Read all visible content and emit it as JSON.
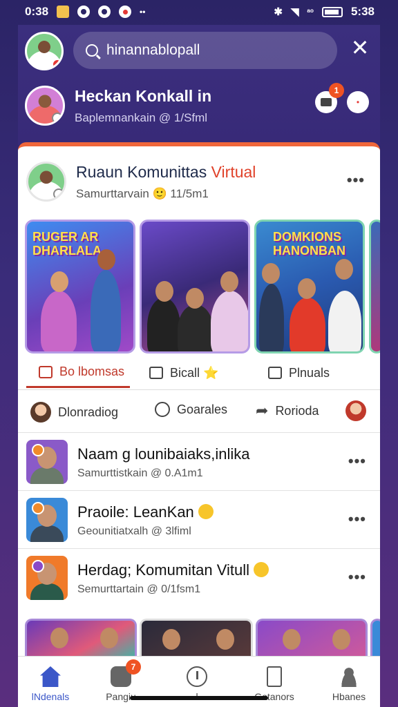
{
  "status_bar": {
    "time": "0:38",
    "right_time": "5:38",
    "network_label": "ᵃᵒ"
  },
  "header": {
    "search_placeholder": "hinannablopall",
    "profile_name": "Heckan Konkall in",
    "profile_sub": "Baplemnankain @ 1/Sfml",
    "notif_count": "1"
  },
  "post": {
    "title_main": "Ruaun Komunittas",
    "title_accent": "Virtual",
    "sub": "Samurttarvain 🙂 11/5m1",
    "stories": [
      {
        "title": "RUGER AR DHARLALA"
      },
      {
        "title": ""
      },
      {
        "title": "DOMKIONS HANONBAN"
      }
    ],
    "tabs": [
      {
        "label": "Bo lbomsas"
      },
      {
        "label": "Bicall ⭐"
      },
      {
        "label": "Plnuals"
      }
    ],
    "actions": [
      {
        "label": "Dlonradiog"
      },
      {
        "label": "Goarales"
      },
      {
        "label": "Rorioda"
      }
    ]
  },
  "feed": [
    {
      "title": "Naam g lounibaiaks,inlika",
      "sub": "Samurttistkain @ 0.A1m1",
      "has_emoji": false
    },
    {
      "title": "Praoile: LeanKan",
      "sub": "Geounitiatxalh @ 3lfiml",
      "has_emoji": true
    },
    {
      "title": "Herdag; Komumitan Vitull",
      "sub": "Semurttartain @ 0/1fsm1",
      "has_emoji": true
    }
  ],
  "bottom_nav": {
    "badge_count": "7",
    "items": [
      {
        "label": "lNdenals",
        "icon": "home-icon"
      },
      {
        "label": "Pangiu",
        "icon": "chat-icon"
      },
      {
        "label": "l",
        "icon": "plus-circle-icon"
      },
      {
        "label": "Gotanors",
        "icon": "bookmark-icon"
      },
      {
        "label": "Hbanes",
        "icon": "person-icon"
      }
    ]
  },
  "colors": {
    "accent": "#c0392b",
    "brand": "#3b57c8",
    "header_bg": "#3b2f7e",
    "card_top_border": "#f0663a"
  }
}
